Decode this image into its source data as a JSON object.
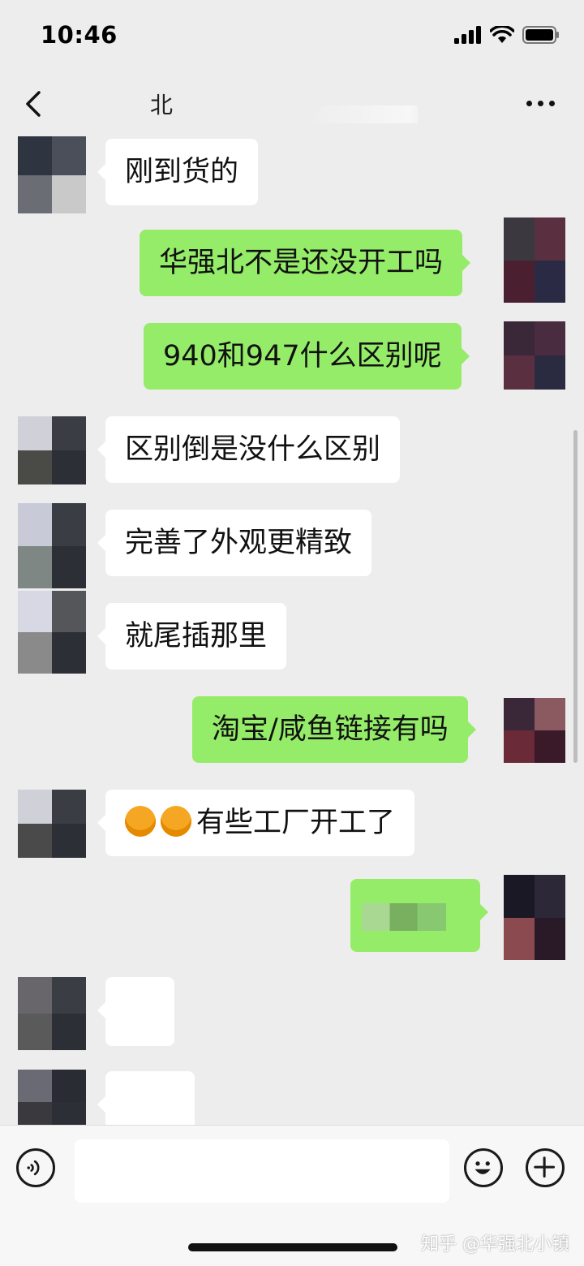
{
  "status": {
    "time": "10:46"
  },
  "nav": {
    "title": "北"
  },
  "messages": [
    {
      "text": "刚到货的"
    },
    {
      "text": "华强北不是还没开工吗"
    },
    {
      "text": "940和947什么区别呢"
    },
    {
      "text": "区别倒是没什么区别"
    },
    {
      "text": "完善了外观更精致"
    },
    {
      "text": "就尾插那里"
    },
    {
      "text": "淘宝/咸鱼链接有吗"
    },
    {
      "text": "有些工厂开工了",
      "emojis": [
        "hugging-emoji",
        "hugging-emoji"
      ]
    }
  ],
  "input": {
    "value": ""
  },
  "watermark": "知乎 @华强北小镇",
  "colors": {
    "background": "#ededed",
    "out_bubble": "#95ec69",
    "in_bubble": "#ffffff"
  }
}
